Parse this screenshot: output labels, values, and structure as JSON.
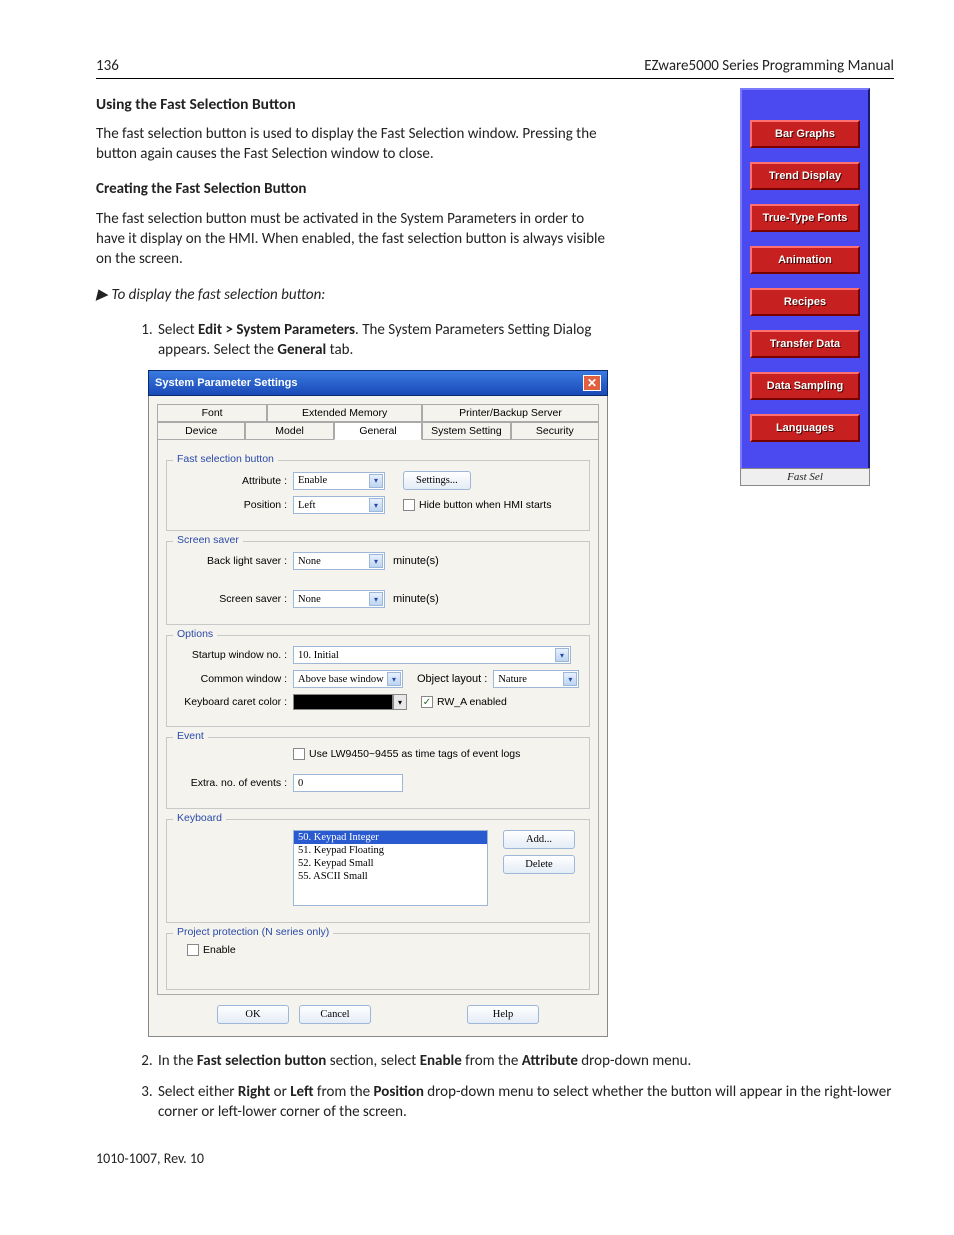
{
  "header": {
    "pagenum": "136",
    "manual": "EZware5000 Series Programming Manual"
  },
  "section": {
    "title": "Using the Fast Selection Button",
    "p1": "The fast selection button is used to display the Fast Selection window. Pressing the button again causes the Fast Selection window to close.",
    "subtitle": "Creating the Fast Selection Button",
    "p2": "The fast selection button must be activated in the System Parameters in order to have it display on the HMI. When enabled, the fast selection button is always visible on the screen.",
    "proc": "To display the fast selection button:",
    "step1a": "Select ",
    "step1b": "Edit > System Parameters",
    "step1c": ". The System Parameters Setting Dialog appears. Select the ",
    "step1d": "General",
    "step1e": " tab.",
    "step2a": "In the ",
    "step2b": "Fast selection button",
    "step2c": " section, select ",
    "step2d": "Enable",
    "step2e": " from the ",
    "step2f": "Attribute",
    "step2g": " drop-down menu.",
    "step3a": "Select either ",
    "step3b": "Right",
    "step3c": " or ",
    "step3d": "Left",
    "step3e": " from the ",
    "step3f": "Position",
    "step3g": " drop-down menu to select whether the button will appear in the right-lower corner or left-lower corner of the screen."
  },
  "fastsel": {
    "buttons": [
      "Bar Graphs",
      "Trend Display",
      "True-Type Fonts",
      "Animation",
      "Recipes",
      "Transfer Data",
      "Data Sampling",
      "Languages"
    ],
    "label": "Fast Sel"
  },
  "dialog": {
    "title": "System Parameter Settings",
    "tabs_row1": [
      "Font",
      "Extended Memory",
      "Printer/Backup Server"
    ],
    "tabs_row2": [
      "Device",
      "Model",
      "General",
      "System Setting",
      "Security"
    ],
    "groups": {
      "fast": {
        "title": "Fast selection button",
        "attribute_label": "Attribute :",
        "attribute_value": "Enable",
        "settings_btn": "Settings...",
        "position_label": "Position :",
        "position_value": "Left",
        "hide_chk": "Hide button when HMI starts"
      },
      "saver": {
        "title": "Screen saver",
        "backlight_label": "Back light saver :",
        "backlight_value": "None",
        "unit1": "minute(s)",
        "screensaver_label": "Screen saver :",
        "screensaver_value": "None",
        "unit2": "minute(s)"
      },
      "options": {
        "title": "Options",
        "startup_label": "Startup window no. :",
        "startup_value": "10. Initial",
        "common_label": "Common window :",
        "common_value": "Above base window",
        "layout_label": "Object layout :",
        "layout_value": "Nature",
        "caret_label": "Keyboard caret color :",
        "rwa_chk": "RW_A enabled"
      },
      "event": {
        "title": "Event",
        "use_chk": "Use LW9450~9455 as time tags of event logs",
        "extra_label": "Extra. no. of events :",
        "extra_value": "0"
      },
      "keyboard": {
        "title": "Keyboard",
        "items": [
          "50. Keypad Integer",
          "51. Keypad Floating",
          "52. Keypad Small",
          "55. ASCII Small"
        ],
        "add_btn": "Add...",
        "delete_btn": "Delete"
      },
      "project": {
        "title": "Project protection (N series only)",
        "enable_chk": "Enable"
      }
    },
    "buttons": {
      "ok": "OK",
      "cancel": "Cancel",
      "help": "Help"
    }
  },
  "footer": "1010-1007, Rev. 10"
}
